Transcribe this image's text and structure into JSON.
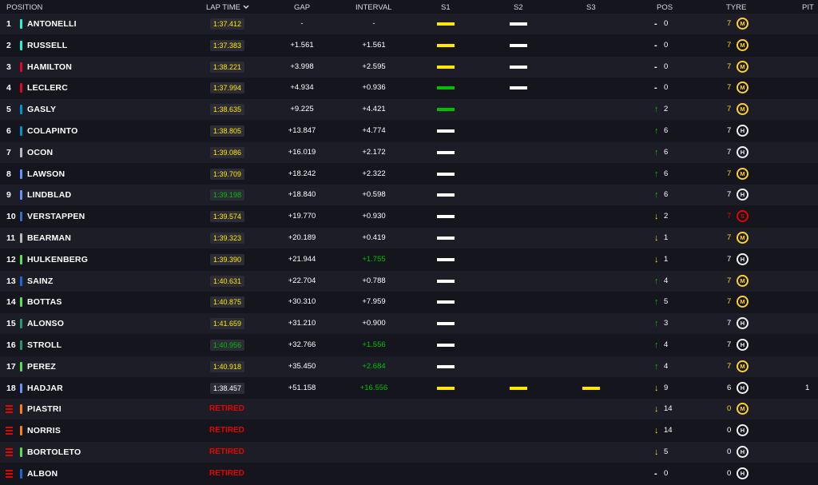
{
  "header": {
    "position": "POSITION",
    "lap_time": "LAP TIME",
    "gap": "GAP",
    "interval": "INTERVAL",
    "s1": "S1",
    "s2": "S2",
    "s3": "S3",
    "pos": "POS",
    "tyre": "TYRE",
    "pit": "PIT"
  },
  "colors": {
    "mercedes": "#27f4d2",
    "ferrari": "#e8002d",
    "alpine": "#0093cc",
    "haas": "#b6babd",
    "racing_bulls": "#6692ff",
    "red_bull": "#3671c6",
    "sauber": "#52e252",
    "williams": "#1868db",
    "aston": "#229971",
    "mclaren": "#ff8000",
    "sector_yellow": "#ffe600",
    "sector_green": "#00c000",
    "sector_white": "#ffffff",
    "medium": "#ffd12e",
    "hard": "#f0f0f0",
    "soft": "#e10600",
    "retired": "#e10600"
  },
  "rows": [
    {
      "pos": "1",
      "name": "ANTONELLI",
      "team": "mercedes",
      "lap": "1:37.412",
      "lap_color": "yellow",
      "gap": "-",
      "interval": "-",
      "interval_color": "white",
      "s1": "yellow",
      "s2": "white",
      "s3": "",
      "arrow": "-",
      "arrow_dir": "none",
      "posval": "0",
      "laps": "7",
      "tyre": "M",
      "tyre_type": "medium",
      "pit": ""
    },
    {
      "pos": "2",
      "name": "RUSSELL",
      "team": "mercedes",
      "lap": "1:37.383",
      "lap_color": "yellow",
      "gap": "+1.561",
      "interval": "+1.561",
      "interval_color": "white",
      "s1": "yellow",
      "s2": "white",
      "s3": "",
      "arrow": "-",
      "arrow_dir": "none",
      "posval": "0",
      "laps": "7",
      "tyre": "M",
      "tyre_type": "medium",
      "pit": ""
    },
    {
      "pos": "3",
      "name": "HAMILTON",
      "team": "ferrari",
      "lap": "1:38.221",
      "lap_color": "yellow",
      "gap": "+3.998",
      "interval": "+2.595",
      "interval_color": "white",
      "s1": "yellow",
      "s2": "white",
      "s3": "",
      "arrow": "-",
      "arrow_dir": "none",
      "posval": "0",
      "laps": "7",
      "tyre": "M",
      "tyre_type": "medium",
      "pit": ""
    },
    {
      "pos": "4",
      "name": "LECLERC",
      "team": "ferrari",
      "lap": "1:37.994",
      "lap_color": "yellow",
      "gap": "+4.934",
      "interval": "+0.936",
      "interval_color": "white",
      "s1": "green",
      "s2": "white",
      "s3": "",
      "arrow": "-",
      "arrow_dir": "none",
      "posval": "0",
      "laps": "7",
      "tyre": "M",
      "tyre_type": "medium",
      "pit": ""
    },
    {
      "pos": "5",
      "name": "GASLY",
      "team": "alpine",
      "lap": "1:38.635",
      "lap_color": "yellow",
      "gap": "+9.225",
      "interval": "+4.421",
      "interval_color": "white",
      "s1": "green",
      "s2": "",
      "s3": "",
      "arrow": "↑",
      "arrow_dir": "up",
      "posval": "2",
      "laps": "7",
      "tyre": "M",
      "tyre_type": "medium",
      "pit": ""
    },
    {
      "pos": "6",
      "name": "COLAPINTO",
      "team": "alpine",
      "lap": "1:38.805",
      "lap_color": "yellow",
      "gap": "+13.847",
      "interval": "+4.774",
      "interval_color": "white",
      "s1": "white",
      "s2": "",
      "s3": "",
      "arrow": "↑",
      "arrow_dir": "up",
      "posval": "6",
      "laps": "7",
      "tyre": "H",
      "tyre_type": "hard",
      "pit": ""
    },
    {
      "pos": "7",
      "name": "OCON",
      "team": "haas",
      "lap": "1:39.086",
      "lap_color": "yellow",
      "gap": "+16.019",
      "interval": "+2.172",
      "interval_color": "white",
      "s1": "white",
      "s2": "",
      "s3": "",
      "arrow": "↑",
      "arrow_dir": "up",
      "posval": "6",
      "laps": "7",
      "tyre": "H",
      "tyre_type": "hard",
      "pit": ""
    },
    {
      "pos": "8",
      "name": "LAWSON",
      "team": "racing_bulls",
      "lap": "1:39.709",
      "lap_color": "yellow",
      "gap": "+18.242",
      "interval": "+2.322",
      "interval_color": "white",
      "s1": "white",
      "s2": "",
      "s3": "",
      "arrow": "↑",
      "arrow_dir": "up",
      "posval": "6",
      "laps": "7",
      "tyre": "M",
      "tyre_type": "medium",
      "pit": ""
    },
    {
      "pos": "9",
      "name": "LINDBLAD",
      "team": "racing_bulls",
      "lap": "1:39.198",
      "lap_color": "green",
      "gap": "+18.840",
      "interval": "+0.598",
      "interval_color": "white",
      "s1": "white",
      "s2": "",
      "s3": "",
      "arrow": "↑",
      "arrow_dir": "up",
      "posval": "6",
      "laps": "7",
      "tyre": "H",
      "tyre_type": "hard",
      "pit": ""
    },
    {
      "pos": "10",
      "name": "VERSTAPPEN",
      "team": "red_bull",
      "lap": "1:39.574",
      "lap_color": "yellow",
      "gap": "+19.770",
      "interval": "+0.930",
      "interval_color": "white",
      "s1": "white",
      "s2": "",
      "s3": "",
      "arrow": "↓",
      "arrow_dir": "down",
      "posval": "2",
      "laps": "7",
      "tyre": "S",
      "tyre_type": "soft",
      "pit": ""
    },
    {
      "pos": "11",
      "name": "BEARMAN",
      "team": "haas",
      "lap": "1:39.323",
      "lap_color": "yellow",
      "gap": "+20.189",
      "interval": "+0.419",
      "interval_color": "white",
      "s1": "white",
      "s2": "",
      "s3": "",
      "arrow": "↓",
      "arrow_dir": "down",
      "posval": "1",
      "laps": "7",
      "tyre": "M",
      "tyre_type": "medium",
      "pit": ""
    },
    {
      "pos": "12",
      "name": "HULKENBERG",
      "team": "sauber",
      "lap": "1:39.390",
      "lap_color": "yellow",
      "gap": "+21.944",
      "interval": "+1.755",
      "interval_color": "green",
      "s1": "white",
      "s2": "",
      "s3": "",
      "arrow": "↓",
      "arrow_dir": "down",
      "posval": "1",
      "laps": "7",
      "tyre": "H",
      "tyre_type": "hard",
      "pit": ""
    },
    {
      "pos": "13",
      "name": "SAINZ",
      "team": "williams",
      "lap": "1:40.631",
      "lap_color": "yellow",
      "gap": "+22.704",
      "interval": "+0.788",
      "interval_color": "white",
      "s1": "white",
      "s2": "",
      "s3": "",
      "arrow": "↑",
      "arrow_dir": "up",
      "posval": "4",
      "laps": "7",
      "tyre": "M",
      "tyre_type": "medium",
      "pit": ""
    },
    {
      "pos": "14",
      "name": "BOTTAS",
      "team": "sauber",
      "lap": "1:40.875",
      "lap_color": "yellow",
      "gap": "+30.310",
      "interval": "+7.959",
      "interval_color": "white",
      "s1": "white",
      "s2": "",
      "s3": "",
      "arrow": "↑",
      "arrow_dir": "up",
      "posval": "5",
      "laps": "7",
      "tyre": "M",
      "tyre_type": "medium",
      "pit": ""
    },
    {
      "pos": "15",
      "name": "ALONSO",
      "team": "aston",
      "lap": "1:41.659",
      "lap_color": "yellow",
      "gap": "+31.210",
      "interval": "+0.900",
      "interval_color": "white",
      "s1": "white",
      "s2": "",
      "s3": "",
      "arrow": "↑",
      "arrow_dir": "up",
      "posval": "3",
      "laps": "7",
      "tyre": "H",
      "tyre_type": "hard",
      "pit": ""
    },
    {
      "pos": "16",
      "name": "STROLL",
      "team": "aston",
      "lap": "1:40.956",
      "lap_color": "green",
      "gap": "+32.766",
      "interval": "+1.556",
      "interval_color": "green",
      "s1": "white",
      "s2": "",
      "s3": "",
      "arrow": "↑",
      "arrow_dir": "up",
      "posval": "4",
      "laps": "7",
      "tyre": "H",
      "tyre_type": "hard",
      "pit": ""
    },
    {
      "pos": "17",
      "name": "PEREZ",
      "team": "sauber",
      "lap": "1:40.918",
      "lap_color": "yellow",
      "gap": "+35.450",
      "interval": "+2.684",
      "interval_color": "green",
      "s1": "white",
      "s2": "",
      "s3": "",
      "arrow": "↑",
      "arrow_dir": "up",
      "posval": "4",
      "laps": "7",
      "tyre": "M",
      "tyre_type": "medium",
      "pit": ""
    },
    {
      "pos": "18",
      "name": "HADJAR",
      "team": "racing_bulls",
      "lap": "1:38.457",
      "lap_color": "white",
      "gap": "+51.158",
      "interval": "+16.556",
      "interval_color": "green",
      "s1": "yellow",
      "s2": "yellow",
      "s3": "yellow",
      "arrow": "↓",
      "arrow_dir": "down",
      "posval": "9",
      "laps": "6",
      "tyre": "H",
      "tyre_type": "hard",
      "pit": "1"
    },
    {
      "pos": "",
      "name": "PIASTRI",
      "team": "mclaren",
      "lap": "RETIRED",
      "lap_color": "retired",
      "gap": "",
      "interval": "",
      "interval_color": "white",
      "s1": "",
      "s2": "",
      "s3": "",
      "arrow": "↓",
      "arrow_dir": "down",
      "posval": "14",
      "laps": "0",
      "tyre": "M",
      "tyre_type": "medium",
      "pit": "",
      "retired": true
    },
    {
      "pos": "",
      "name": "NORRIS",
      "team": "mclaren",
      "lap": "RETIRED",
      "lap_color": "retired",
      "gap": "",
      "interval": "",
      "interval_color": "white",
      "s1": "",
      "s2": "",
      "s3": "",
      "arrow": "↓",
      "arrow_dir": "down",
      "posval": "14",
      "laps": "0",
      "tyre": "H",
      "tyre_type": "hard",
      "pit": "",
      "retired": true
    },
    {
      "pos": "",
      "name": "BORTOLETO",
      "team": "sauber",
      "lap": "RETIRED",
      "lap_color": "retired",
      "gap": "",
      "interval": "",
      "interval_color": "white",
      "s1": "",
      "s2": "",
      "s3": "",
      "arrow": "↓",
      "arrow_dir": "down",
      "posval": "5",
      "laps": "0",
      "tyre": "H",
      "tyre_type": "hard",
      "pit": "",
      "retired": true
    },
    {
      "pos": "",
      "name": "ALBON",
      "team": "williams",
      "lap": "RETIRED",
      "lap_color": "retired",
      "gap": "",
      "interval": "",
      "interval_color": "white",
      "s1": "",
      "s2": "",
      "s3": "",
      "arrow": "-",
      "arrow_dir": "none",
      "posval": "0",
      "laps": "0",
      "tyre": "H",
      "tyre_type": "hard",
      "pit": "",
      "retired": true
    }
  ]
}
